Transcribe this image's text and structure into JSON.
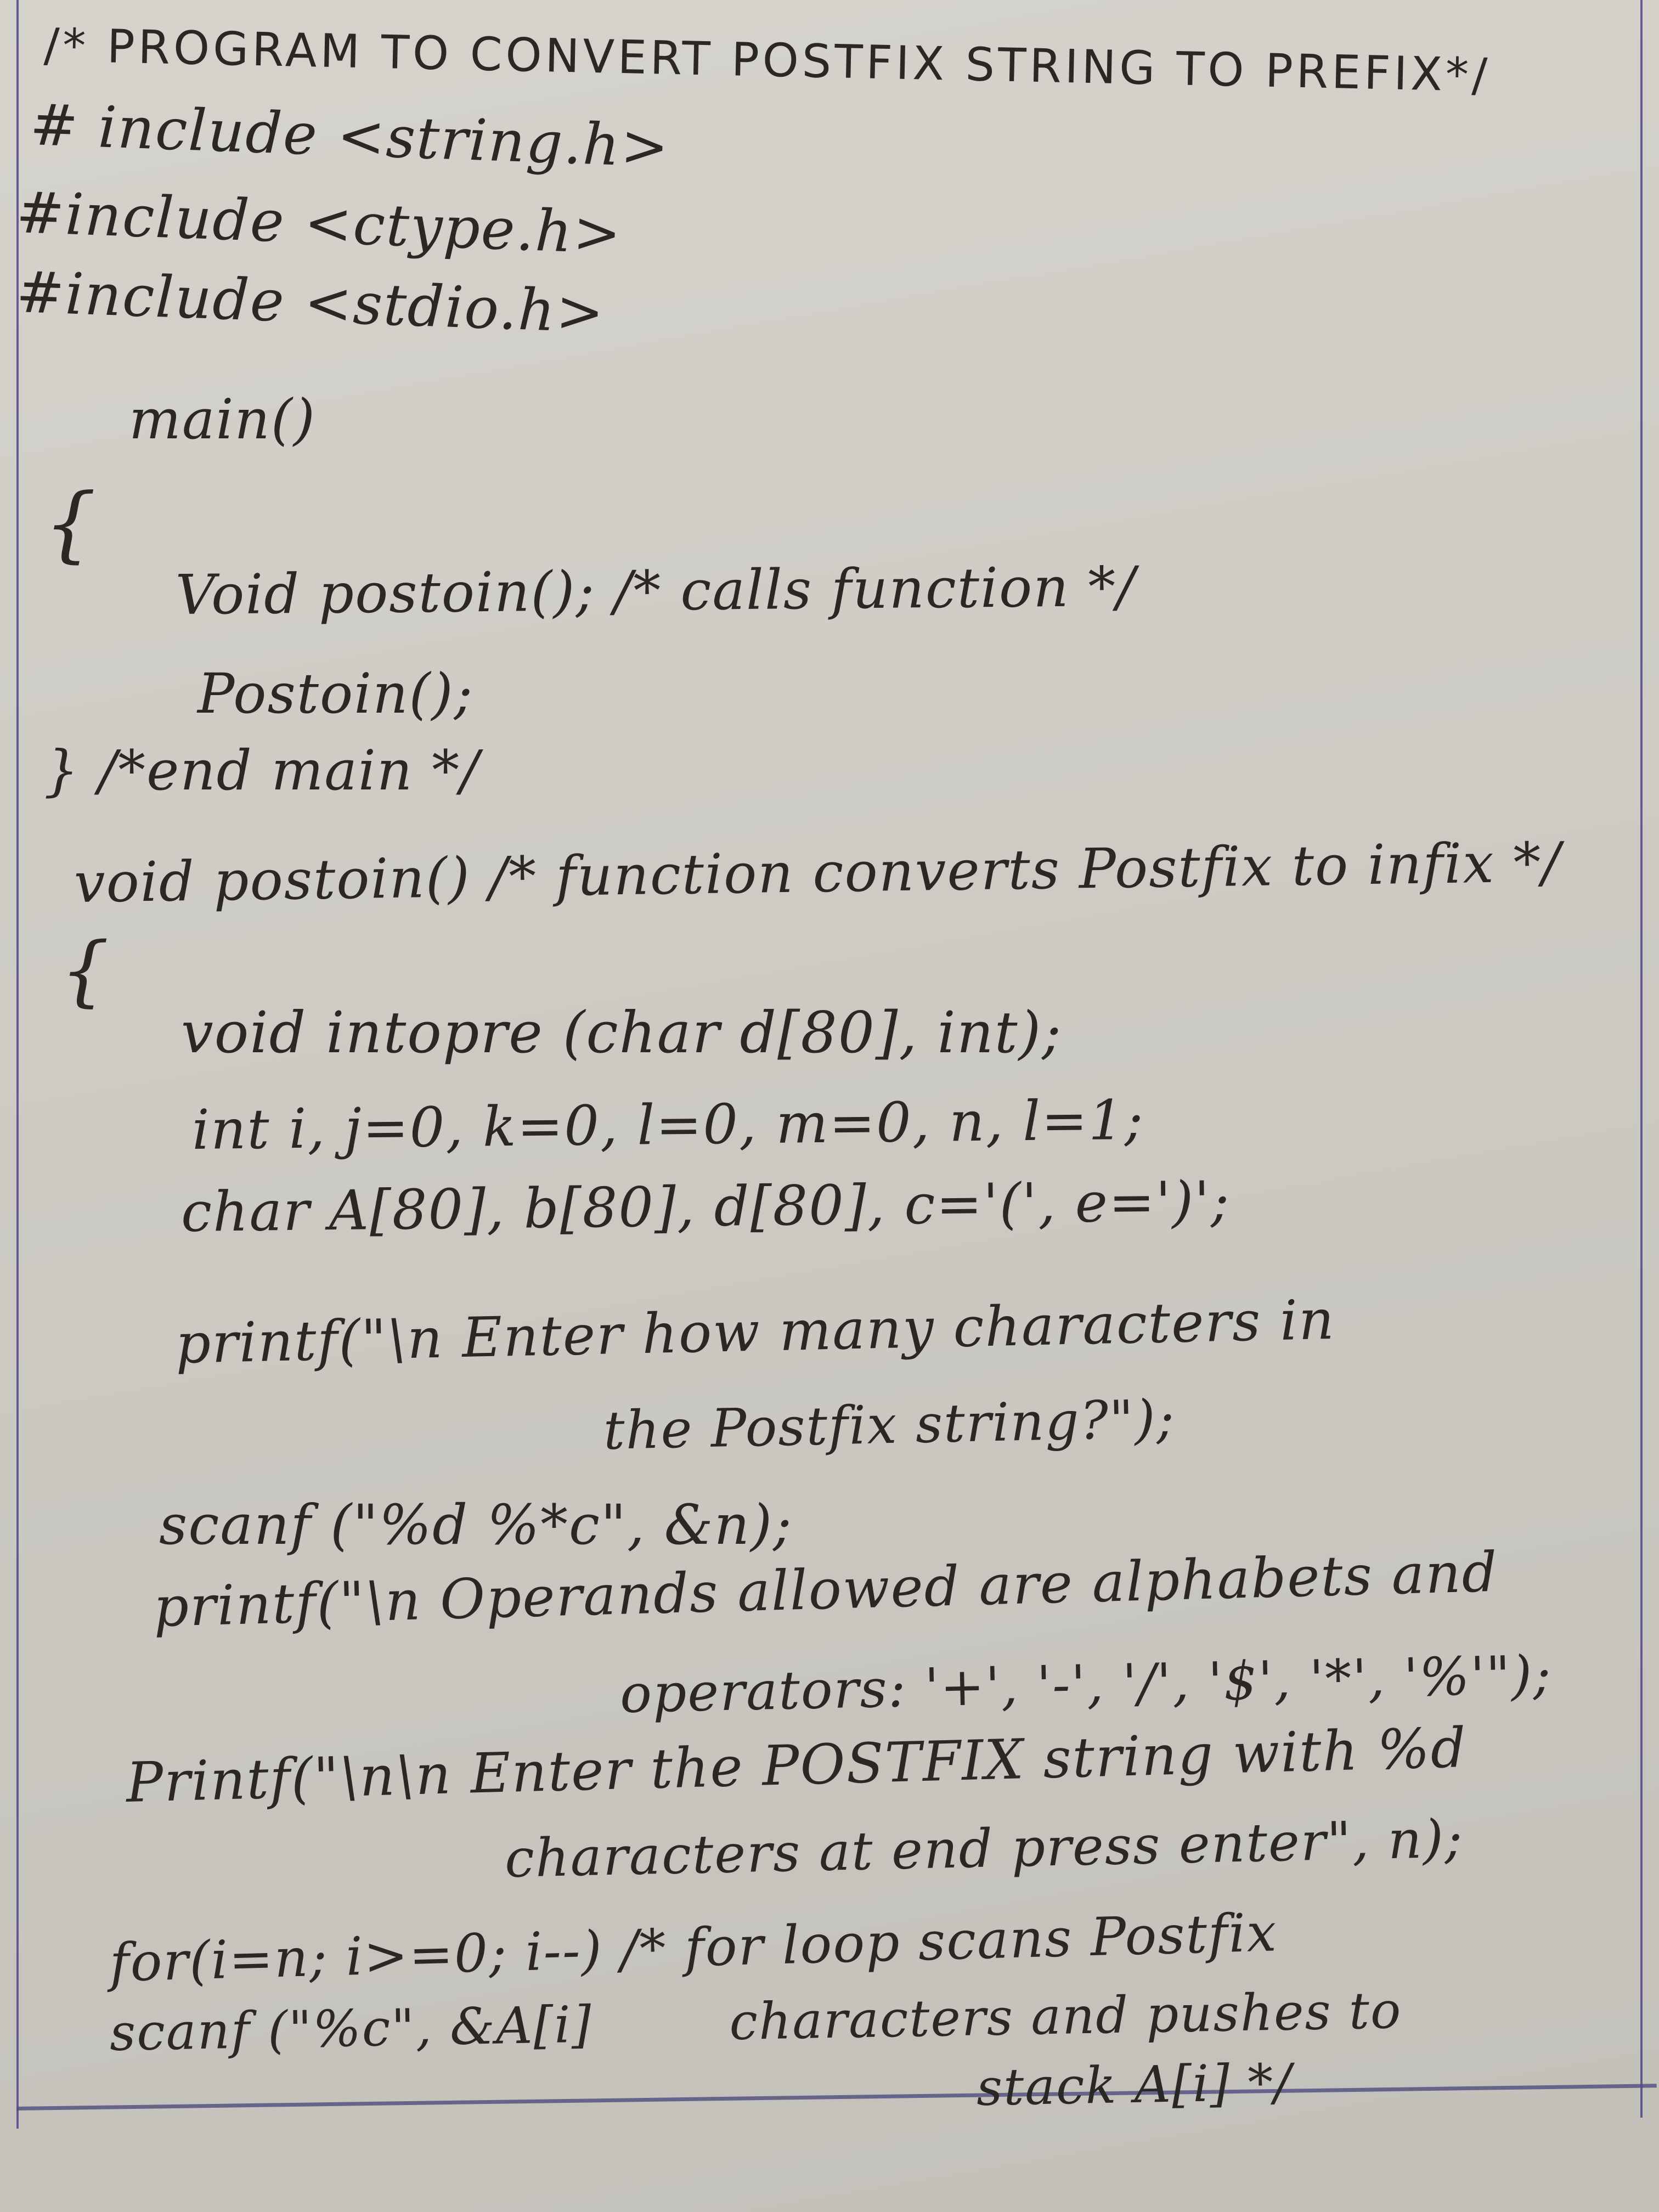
{
  "document": {
    "type": "handwritten-notes",
    "paper_color": "#cfccc6",
    "ink_color": "#2a2724",
    "margin_line_color": "#4b4a86",
    "title": "/* PROGRAM TO CONVERT POSTFIX STRING TO PREFIX*/",
    "includes": [
      "# include <string.h>",
      "#include <ctype.h>",
      "#include <stdio.h>"
    ],
    "main_block": {
      "signature": "main()",
      "open_brace": "{",
      "decl": "Void postoin(); /* calls function */",
      "call": "Postoin();",
      "close": "} /*end main */"
    },
    "postoin_block": {
      "signature": "void postoin() /* function converts Postfix to infix */",
      "open_brace": "{",
      "lines": [
        "void intopre (char d[80], int);",
        "int i, j=0, k=0, l=0, m=0, n, l=1;",
        "char A[80], b[80], d[80], c='(', e=')';"
      ]
    },
    "statements": [
      "printf(\"\\n Enter how many characters in",
      "the Postfix string?\");",
      "scanf (\"%d %*c\", &n);",
      "printf(\"\\n Operands allowed are alphabets and",
      "operators: '+', '-', '/', '$', '*', '%'\");",
      "Printf(\"\\n\\n Enter the POSTFIX string with %d",
      "characters at end press enter\", n);",
      "for(i=n; i>=0; i--) /* for loop scans Postfix",
      "scanf (\"%c\", &A[i]        characters and pushes to",
      "stack A[i] */"
    ]
  }
}
